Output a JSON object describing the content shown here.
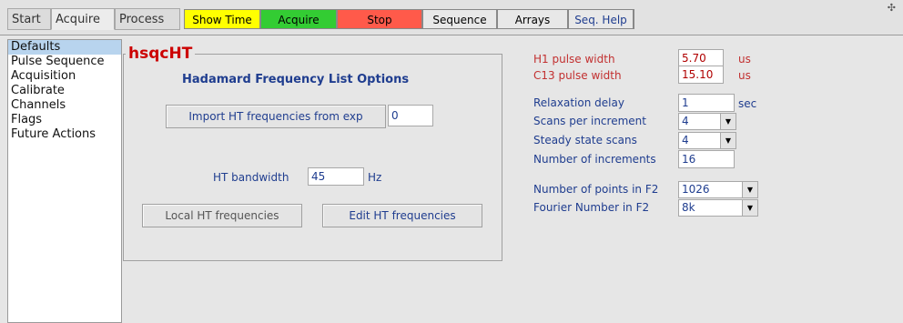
{
  "tabs": [
    "Start",
    "Acquire",
    "Process"
  ],
  "toolbar": {
    "show_time": "Show Time",
    "acquire": "Acquire",
    "stop": "Stop",
    "sequence": "Sequence",
    "arrays": "Arrays",
    "seq_help": "Seq. Help",
    "colors": {
      "show_time": "#ffff00",
      "acquire": "#33cc33",
      "stop": "#ff5a4a"
    }
  },
  "sidebar": {
    "items": [
      "Defaults",
      "Pulse Sequence",
      "Acquisition",
      "Calibrate",
      "Channels",
      "Flags",
      "Future Actions"
    ],
    "selected": "Defaults"
  },
  "panel": {
    "title": "hsqcHT",
    "heading": "Hadamard Frequency List Options",
    "import_button": "Import HT frequencies from exp",
    "import_value": "0",
    "bandwidth_label": "HT bandwidth",
    "bandwidth_value": "45",
    "bandwidth_unit": "Hz",
    "local_button": "Local HT frequencies",
    "edit_button": "Edit HT frequencies"
  },
  "params": {
    "h1_pw_label": "H1 pulse width",
    "h1_pw_value": "5.70",
    "h1_pw_unit": "us",
    "c13_pw_label": "C13 pulse width",
    "c13_pw_value": "15.10",
    "c13_pw_unit": "us",
    "relax_label": "Relaxation delay",
    "relax_value": "1",
    "relax_unit": "sec",
    "scans_label": "Scans per increment",
    "scans_value": "4",
    "ss_label": "Steady state scans",
    "ss_value": "4",
    "incr_label": "Number of increments",
    "incr_value": "16",
    "np_label": "Number of points in F2",
    "np_value": "1026",
    "fn_label": "Fourier Number in F2",
    "fn_value": "8k"
  }
}
